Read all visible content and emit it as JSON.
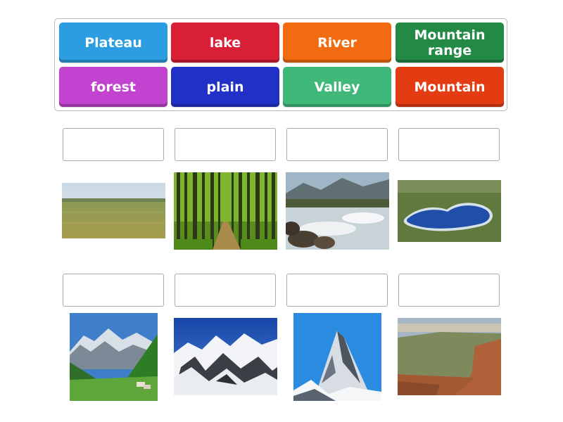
{
  "word_bank": {
    "tiles": [
      {
        "label": "Plateau",
        "color": "#2c9de0"
      },
      {
        "label": "lake",
        "color": "#d81f35"
      },
      {
        "label": "River",
        "color": "#f26b11"
      },
      {
        "label": "Mountain range",
        "color": "#228a45"
      },
      {
        "label": "forest",
        "color": "#c143cf"
      },
      {
        "label": "plain",
        "color": "#2131c8"
      },
      {
        "label": "Valley",
        "color": "#40b87a"
      },
      {
        "label": "Mountain",
        "color": "#e33c12"
      }
    ]
  },
  "images": [
    {
      "name": "plain-image"
    },
    {
      "name": "forest-image"
    },
    {
      "name": "river-image"
    },
    {
      "name": "lake-image"
    },
    {
      "name": "valley-image"
    },
    {
      "name": "mountain-range-image"
    },
    {
      "name": "mountain-image"
    },
    {
      "name": "plateau-image"
    }
  ]
}
